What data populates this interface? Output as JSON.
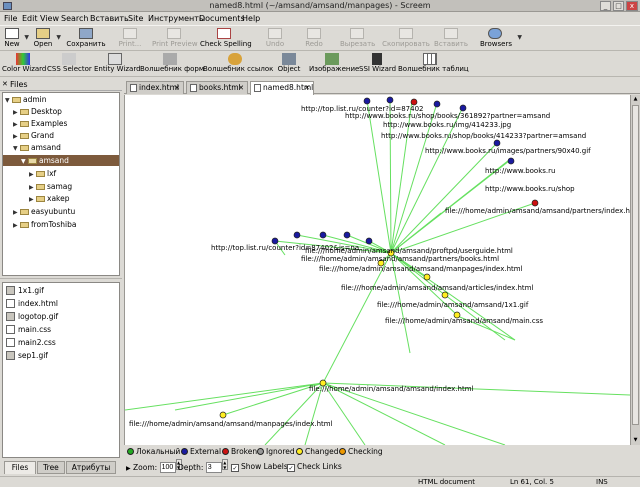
{
  "window": {
    "title": "named8.html (~/amsand/amsand/manpages) - Screem"
  },
  "menu": [
    "File",
    "Edit",
    "View",
    "Search",
    "Вставить",
    "Site",
    "Инструменты",
    "Documents",
    "Help"
  ],
  "toolbar": {
    "new": "New",
    "open": "Open",
    "save": "Сохранить",
    "print": "Print...",
    "print_preview": "Print Preview",
    "check_spelling": "Check Spelling",
    "undo": "Undo",
    "redo": "Redo",
    "cut": "Вырезать",
    "copy": "Скопировать",
    "paste": "Вставить",
    "browsers": "Browsers"
  },
  "wizards": [
    "Color Wizard",
    "CSS Selector",
    "Entity Wizard",
    "Волшебник форм",
    "Волшебник ссылок",
    "Object",
    "Изображение",
    "SSI Wizard",
    "Волшебник таблиц"
  ],
  "sidebar": {
    "header": "Files",
    "tree": [
      "admin",
      "Desktop",
      "Examples",
      "Grand",
      "amsand",
      "amsand",
      "lxf",
      "samag",
      "xakep",
      "easyubuntu",
      "fromToshiba"
    ],
    "files": [
      "1x1.gif",
      "index.html",
      "logotop.gif",
      "main.css",
      "main2.css",
      "sep1.gif"
    ],
    "tabs": [
      "Files",
      "Tree",
      "Атрибуты"
    ]
  },
  "doc_tabs": [
    "index.html",
    "books.html",
    "named8.html"
  ],
  "graph": {
    "labels": [
      "http://top.list.ru/counter?id=87402",
      "http://www.books.ru/shop/books/361892?partner=amsand",
      "http://www.books.ru/img/414233.jpg",
      "http://www.books.ru/shop/books/414233?partner=amsand",
      "http://www.books.ru/images/partners/90x40.gif",
      "http://www.books.ru",
      "http://www.books.ru/shop",
      "file:///home/admin/amsand/amsand/partners/index.html",
      "http://top.list.ru/counter?id=87402&js=na",
      "file:///home/admin/amsand/amsand/proftpd/userguide.html",
      "file:///home/admin/amsand/amsand/partners/books.html",
      "file:///home/admin/amsand/amsand/manpages/index.html",
      "file:///home/admin/amsand/amsand/articles/index.html",
      "file:///home/admin/amsand/amsand/1x1.gif",
      "file:///home/admin/amsand/amsand/main.css",
      "file:///home/admin/amsand/amsand/index.html",
      "file:///home/admin/amsand/amsand/manpages/index.html"
    ]
  },
  "legend": [
    {
      "label": "Локальный",
      "color": "#22aa22"
    },
    {
      "label": "External",
      "color": "#1a1aa0"
    },
    {
      "label": "Broken",
      "color": "#cc1111"
    },
    {
      "label": "Ignored",
      "color": "#999999"
    },
    {
      "label": "Changed",
      "color": "#ffee22"
    },
    {
      "label": "Checking",
      "color": "#ee9900"
    }
  ],
  "controls": {
    "zoom_label": "Zoom:",
    "zoom": "100",
    "depth_label": "Depth:",
    "depth": "3",
    "show_labels": "Show Labels",
    "check_links": "Check Links"
  },
  "status": {
    "doc_type": "HTML document",
    "position": "Ln 61, Col. 5",
    "mode": "INS"
  },
  "colors": {
    "edge": "#66e060",
    "selection": "#7d5a3c"
  }
}
